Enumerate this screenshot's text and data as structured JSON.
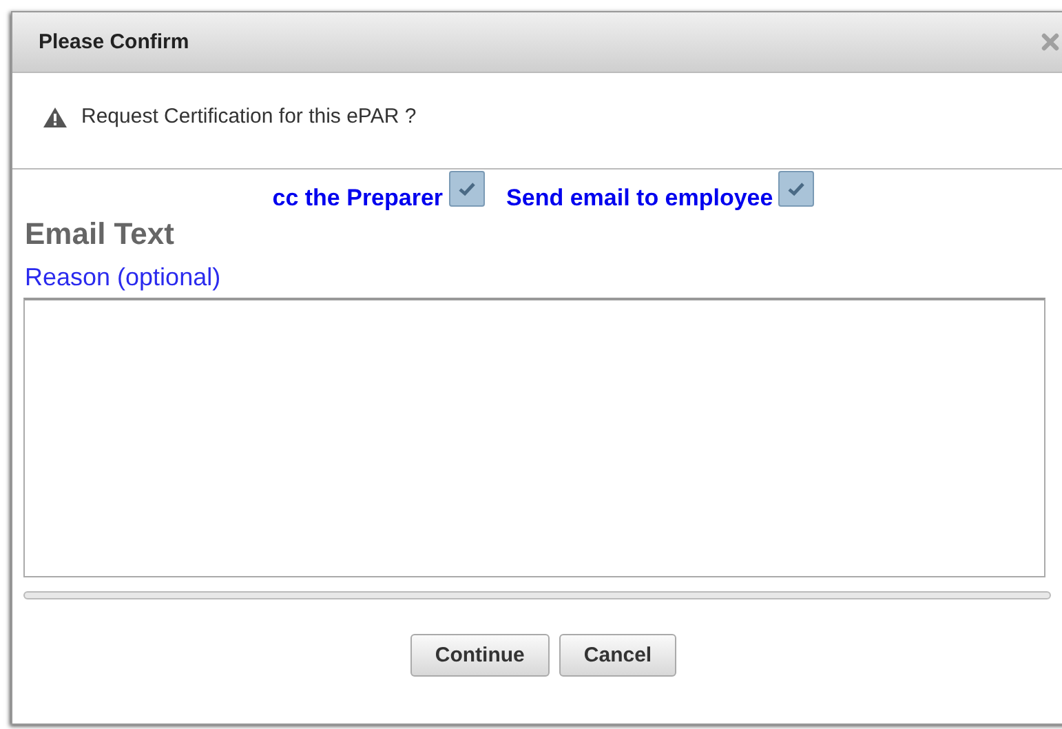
{
  "dialog": {
    "title": "Please Confirm",
    "message": "Request Certification for this ePAR ?"
  },
  "options": [
    {
      "label": "cc the Preparer",
      "checked": true
    },
    {
      "label": "Send email to employee",
      "checked": true
    }
  ],
  "email_section": {
    "heading": "Email Text",
    "reason_label": "Reason (optional)"
  },
  "buttons": [
    "Continue",
    "Cancel"
  ]
}
